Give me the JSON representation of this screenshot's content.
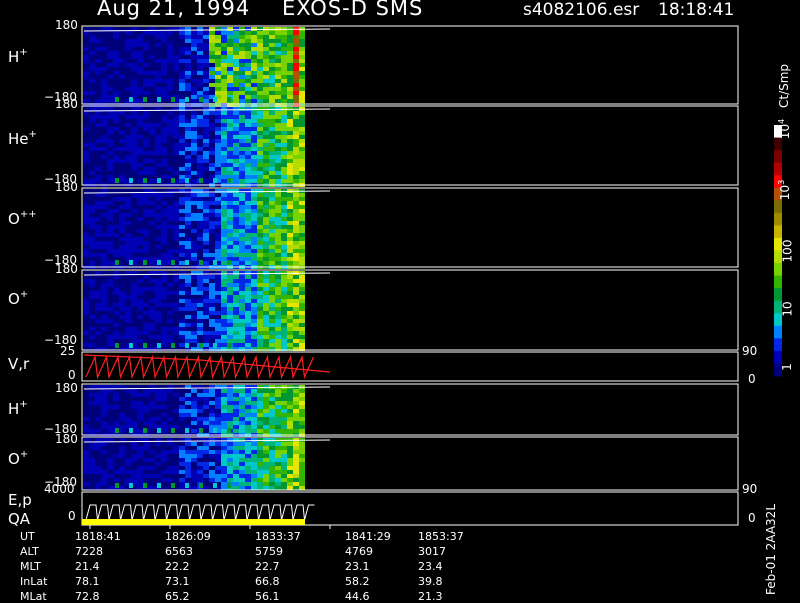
{
  "header": {
    "date": "Aug 21, 1994",
    "instrument": "EXOS-D SMS",
    "file": "s4082106.esr",
    "time": "18:18:41"
  },
  "colorbar": {
    "unit": "Ct/Smp",
    "ticks": [
      "1",
      "10",
      "100",
      "10^3",
      "10^4"
    ],
    "colors": [
      "#00007a",
      "#0000b4",
      "#0028e6",
      "#0080ff",
      "#00c8c8",
      "#00b478",
      "#009632",
      "#32b400",
      "#78d200",
      "#b4dc00",
      "#e6e600",
      "#c8b400",
      "#a08c00",
      "#7a6e00",
      "#b45000",
      "#ff0000",
      "#b40000",
      "#780000",
      "#3c0000",
      "#ffffff"
    ]
  },
  "panels": [
    {
      "base": "H",
      "sup": "+",
      "ymax": "180",
      "ymin": "−180"
    },
    {
      "base": "He",
      "sup": "+",
      "ymax": "180",
      "ymin": "−180"
    },
    {
      "base": "O",
      "sup": "++",
      "ymax": "180",
      "ymin": "−180"
    },
    {
      "base": "O",
      "sup": "+",
      "ymax": "180",
      "ymin": "−180"
    },
    {
      "base": "V,r",
      "sup": "",
      "ymax": "25",
      "ymin": "0",
      "rmax": "90",
      "rmin": "0"
    },
    {
      "base": "H",
      "sup": "+",
      "ymax": "180",
      "ymin": "−180"
    },
    {
      "base": "O",
      "sup": "+",
      "ymax": "180",
      "ymin": "−180"
    },
    {
      "base": "E,p",
      "sup": "",
      "ymax": "4000",
      "ymin": "0",
      "rmax": "90",
      "rmin": "0",
      "sublabel": "QA"
    }
  ],
  "ephemeris": {
    "rows": [
      {
        "name": "UT",
        "values": [
          "1818:41",
          "1826:09",
          "1833:37",
          "1841:29",
          "1853:37"
        ]
      },
      {
        "name": "ALT",
        "values": [
          "7228",
          "6563",
          "5759",
          "4769",
          "3017"
        ]
      },
      {
        "name": "MLT",
        "values": [
          "21.4",
          "22.2",
          "22.7",
          "23.1",
          "23.4"
        ]
      },
      {
        "name": "InLat",
        "values": [
          "78.1",
          "73.1",
          "66.8",
          "58.2",
          "39.8"
        ]
      },
      {
        "name": "MLat",
        "values": [
          "72.8",
          "65.2",
          "56.1",
          "44.6",
          "21.3"
        ]
      }
    ]
  },
  "footer_stamp": "Feb-01 2AA32L"
}
